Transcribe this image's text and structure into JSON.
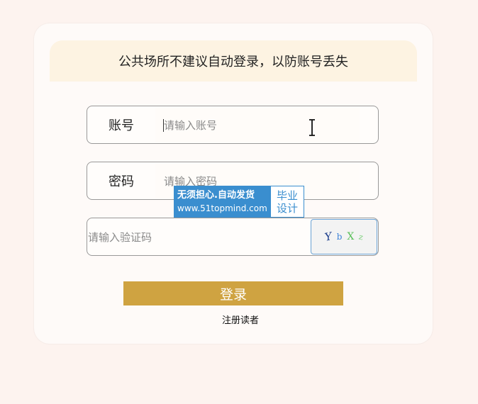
{
  "notice": {
    "text": "公共场所不建议自动登录，以防账号丢失"
  },
  "account": {
    "label": "账号",
    "placeholder": "请输入账号"
  },
  "password": {
    "label": "密码",
    "placeholder": "请输入密码"
  },
  "captcha": {
    "placeholder": "请输入验证码",
    "chars": [
      "Y",
      "b",
      "X",
      "z"
    ]
  },
  "login_button": {
    "label": "登录"
  },
  "register_link": {
    "label": "注册读者"
  },
  "watermark": {
    "line1": "无须担心.自动发货",
    "line2": "www.51topmind.com",
    "badge1": "毕业",
    "badge2": "设计"
  },
  "colors": {
    "background": "#fdf3ef",
    "card": "#fefaf8",
    "notice_bg": "#fdf3e2",
    "login_button": "#cfa341",
    "watermark_blue": "#3a8ecf"
  }
}
